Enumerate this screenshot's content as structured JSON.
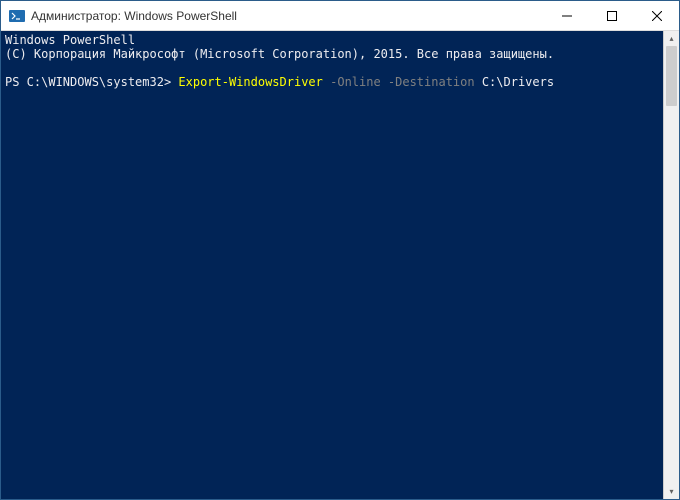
{
  "titlebar": {
    "title": "Администратор: Windows PowerShell"
  },
  "console": {
    "line1": "Windows PowerShell",
    "line2": "(C) Корпорация Майкрософт (Microsoft Corporation), 2015. Все права защищены.",
    "prompt": "PS C:\\WINDOWS\\system32> ",
    "command": "Export-WindowsDriver",
    "param1": " -Online",
    "param2": " -Destination",
    "arg": " C:\\Drivers"
  }
}
